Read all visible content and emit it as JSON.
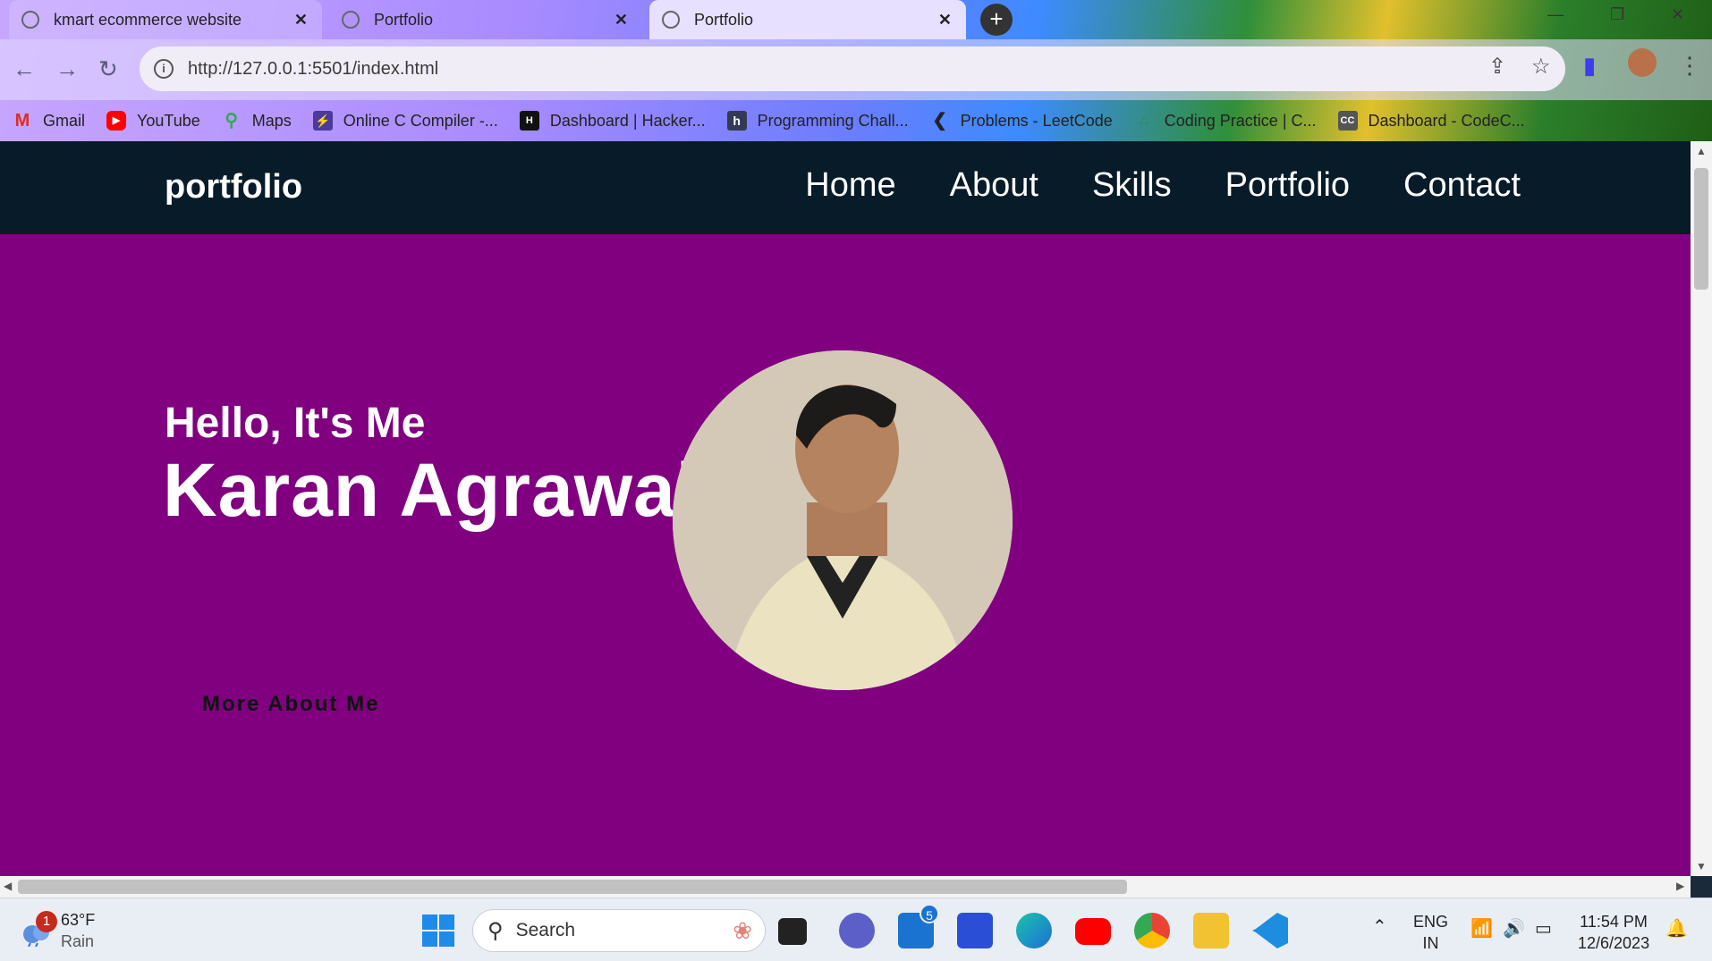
{
  "browser": {
    "tabs": [
      {
        "title": "kmart ecommerce website",
        "active": false
      },
      {
        "title": "Portfolio",
        "active": false
      },
      {
        "title": "Portfolio",
        "active": true
      }
    ],
    "url": "http://127.0.0.1:5501/index.html",
    "bookmarks": [
      {
        "label": "Gmail",
        "icon": "gmail-icon"
      },
      {
        "label": "YouTube",
        "icon": "youtube-icon"
      },
      {
        "label": "Maps",
        "icon": "maps-icon"
      },
      {
        "label": "Online C Compiler -...",
        "icon": "compiler-icon"
      },
      {
        "label": "Dashboard | Hacker...",
        "icon": "hackerrank-icon"
      },
      {
        "label": "Programming Chall...",
        "icon": "hackerearth-icon"
      },
      {
        "label": "Problems - LeetCode",
        "icon": "leetcode-icon"
      },
      {
        "label": "Coding Practice | C...",
        "icon": "gfg-icon"
      },
      {
        "label": "Dashboard - CodeC...",
        "icon": "codechef-icon"
      }
    ]
  },
  "site": {
    "logo": "portfolio",
    "menu": [
      "Home",
      "About",
      "Skills",
      "Portfolio",
      "Contact"
    ],
    "hero": {
      "greeting": "Hello, It's Me",
      "name": "Karan Agrawal",
      "button": "More About Me"
    },
    "colors": {
      "nav_bg": "#081b29",
      "hero_bg": "#800080"
    }
  },
  "taskbar": {
    "weather_temp": "63°F",
    "weather_desc": "Rain",
    "weather_badge": "1",
    "search_placeholder": "Search",
    "mail_badge": "5",
    "lang_top": "ENG",
    "lang_bottom": "IN",
    "time": "11:54 PM",
    "date": "12/6/2023"
  }
}
